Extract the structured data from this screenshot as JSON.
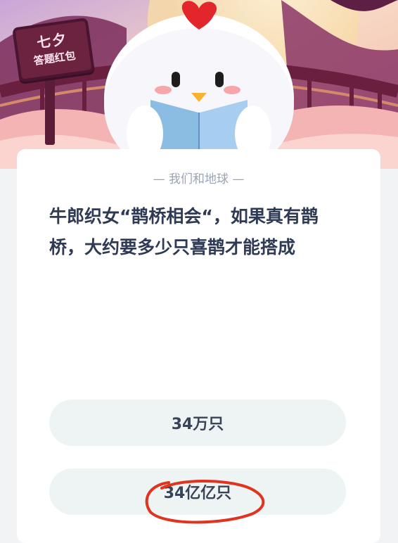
{
  "banner": {
    "sign_line1": "七夕",
    "sign_line2": "答题红包"
  },
  "quiz": {
    "category": "— 我们和地球 —",
    "question": "牛郎织女“鹊桥相会“，如果真有鹊桥，大约要多少只喜鹊才能搭成",
    "options": [
      {
        "label": "34万只"
      },
      {
        "label": "34亿亿只"
      }
    ]
  },
  "colors": {
    "annotation_stroke": "#e0341e",
    "card_bg": "#ffffff",
    "option_bg": "#eef3f3",
    "question_text": "#2f3a55"
  }
}
